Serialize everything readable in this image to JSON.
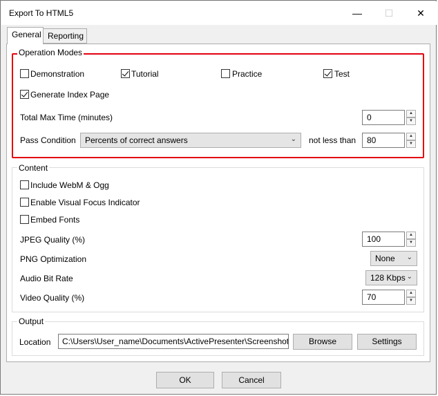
{
  "window": {
    "title": "Export To HTML5",
    "minimize": "—",
    "maximize": "☐",
    "close": "✕"
  },
  "tabs": [
    {
      "label": "General",
      "active": true
    },
    {
      "label": "Reporting",
      "active": false
    }
  ],
  "operation_modes": {
    "title": "Operation Modes",
    "demonstration": {
      "label": "Demonstration",
      "checked": false
    },
    "tutorial": {
      "label": "Tutorial",
      "checked": true
    },
    "practice": {
      "label": "Practice",
      "checked": false
    },
    "test": {
      "label": "Test",
      "checked": true
    },
    "generate_index": {
      "label": "Generate Index Page",
      "checked": true
    },
    "total_max_time": {
      "label": "Total Max Time (minutes)",
      "value": "0"
    },
    "pass_condition": {
      "label": "Pass Condition",
      "selected": "Percents of correct answers",
      "not_less_than_label": "not less than",
      "value": "80"
    }
  },
  "content": {
    "title": "Content",
    "webm": {
      "label": "Include WebM & Ogg",
      "checked": false
    },
    "visual_focus": {
      "label": "Enable Visual Focus Indicator",
      "checked": false
    },
    "embed_fonts": {
      "label": "Embed Fonts",
      "checked": false
    },
    "jpeg_quality": {
      "label": "JPEG Quality (%)",
      "value": "100"
    },
    "png_optimization": {
      "label": "PNG Optimization",
      "selected": "None"
    },
    "audio_bit_rate": {
      "label": "Audio Bit Rate",
      "selected": "128 Kbps"
    },
    "video_quality": {
      "label": "Video Quality (%)",
      "value": "70"
    }
  },
  "output": {
    "title": "Output",
    "location_label": "Location",
    "location_value": "C:\\Users\\User_name\\Documents\\ActivePresenter\\Screenshots",
    "browse_label": "Browse",
    "settings_label": "Settings"
  },
  "footer": {
    "ok_label": "OK",
    "cancel_label": "Cancel"
  },
  "colors": {
    "highlight_border": "#e3000f"
  }
}
